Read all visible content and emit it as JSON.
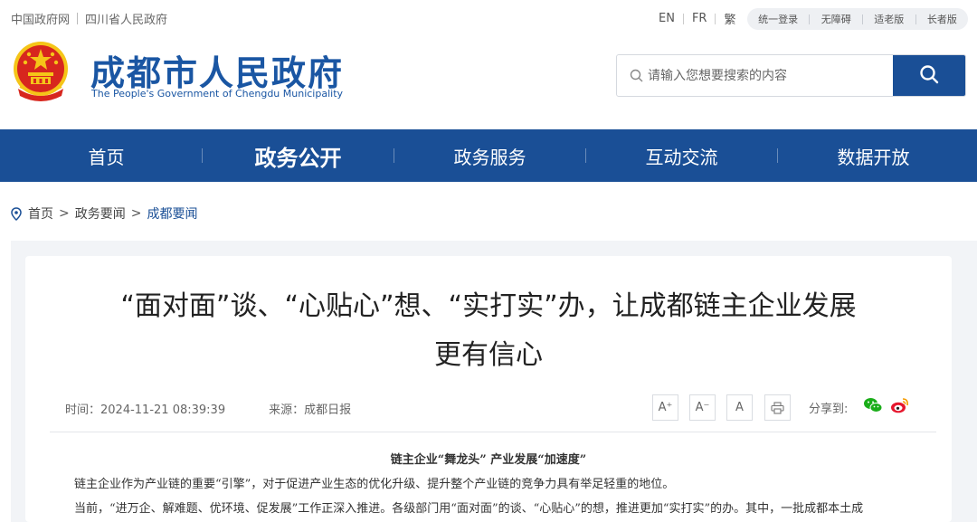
{
  "topbar": {
    "left_links": [
      "中国政府网",
      "四川省人民政府"
    ],
    "langs": [
      "EN",
      "FR",
      "繁"
    ],
    "tools": [
      "统一登录",
      "无障碍",
      "适老版",
      "长者版"
    ]
  },
  "header": {
    "title": "成都市人民政府",
    "subtitle": "The People's Government of Chengdu Municipality",
    "emblem_icon": "national-emblem-icon"
  },
  "search": {
    "placeholder": "请输入您想要搜索的内容",
    "value": ""
  },
  "nav": {
    "items": [
      "首页",
      "政务公开",
      "政务服务",
      "互动交流",
      "数据开放"
    ],
    "active": "政务公开"
  },
  "breadcrumb": {
    "items": [
      "首页",
      "政务要闻",
      "成都要闻"
    ],
    "separator": ">"
  },
  "article": {
    "title_line1": "“面对面”谈、“心贴心”想、“实打实”办，让成都链主企业发展",
    "title_line2": "更有信心",
    "time_label": "时间：",
    "time": "2024-11-21 08:39:39",
    "source_label": "来源：",
    "source": "成都日报",
    "font_buttons": [
      "A⁺",
      "A⁻",
      "A"
    ],
    "share_label": "分享到:",
    "subhead": "链主企业“舞龙头”  产业发展“加速度”",
    "para1": "链主企业作为产业链的重要“引擎”，对于促进产业生态的优化升级、提升整个产业链的竞争力具有举足轻重的地位。",
    "para2": "当前，“进万企、解难题、优环境、促发展”工作正深入推进。各级部门用“面对面”的谈、“心贴心”的想，推进更加“实打实”的办。其中，一批成都本土成"
  },
  "colors": {
    "brand_blue": "#1a4f96",
    "title_blue": "#1a56a3",
    "emblem_red": "#d7261e",
    "emblem_gold": "#f5c518",
    "wechat_green": "#1aad19",
    "weibo_red": "#e6162d"
  }
}
